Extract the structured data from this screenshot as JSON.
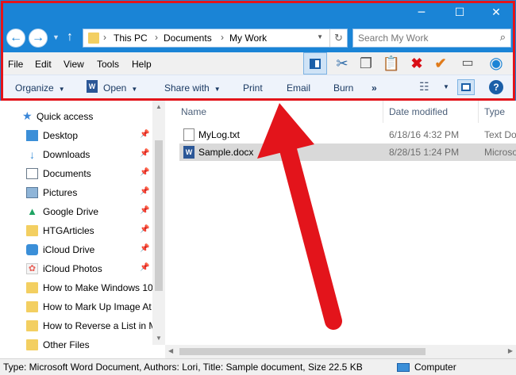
{
  "window": {
    "controls": {
      "minimize": "─",
      "maximize": "☐",
      "close": "✕"
    }
  },
  "address": {
    "crumbs": [
      "This PC",
      "Documents",
      "My Work"
    ],
    "refresh_icon": "refresh-icon"
  },
  "search": {
    "placeholder": "Search My Work"
  },
  "menubar": {
    "items": [
      "File",
      "Edit",
      "View",
      "Tools",
      "Help"
    ],
    "toolbar_icons": [
      "pane-icon",
      "cut-icon",
      "copy-icon",
      "paste-icon",
      "delete-icon",
      "check-icon",
      "rename-icon",
      "shell-icon"
    ]
  },
  "commandbar": {
    "organize": "Organize",
    "open": "Open",
    "share_with": "Share with",
    "print": "Print",
    "email": "Email",
    "burn": "Burn",
    "more": "»"
  },
  "nav": {
    "items": [
      {
        "label": "Quick access",
        "icon": "star-icon"
      },
      {
        "label": "Desktop",
        "icon": "desktop-icon"
      },
      {
        "label": "Downloads",
        "icon": "download-icon"
      },
      {
        "label": "Documents",
        "icon": "documents-icon"
      },
      {
        "label": "Pictures",
        "icon": "pictures-icon"
      },
      {
        "label": "Google Drive",
        "icon": "google-drive-icon"
      },
      {
        "label": "HTGArticles",
        "icon": "folder-icon"
      },
      {
        "label": "iCloud Drive",
        "icon": "icloud-icon"
      },
      {
        "label": "iCloud Photos",
        "icon": "icloud-photos-icon"
      },
      {
        "label": "How to Make Windows 10",
        "icon": "folder-icon"
      },
      {
        "label": "How to Mark Up Image At",
        "icon": "folder-icon"
      },
      {
        "label": "How to Reverse a List in M",
        "icon": "folder-icon"
      },
      {
        "label": "Other Files",
        "icon": "folder-icon"
      }
    ]
  },
  "list": {
    "columns": [
      "Name",
      "Date modified",
      "Type"
    ],
    "rows": [
      {
        "name": "MyLog.txt",
        "date": "6/18/16 4:32 PM",
        "type": "Text Do"
      },
      {
        "name": "Sample.docx",
        "date": "8/28/15 1:24 PM",
        "type": "Microso"
      }
    ]
  },
  "status": {
    "details": "Type: Microsoft Word Document, Authors: Lori, Title: Sample document, Size:",
    "size": "22.5 KB",
    "location": "Computer"
  },
  "colors": {
    "accent": "#1a84d6",
    "highlight": "#e3141b"
  }
}
